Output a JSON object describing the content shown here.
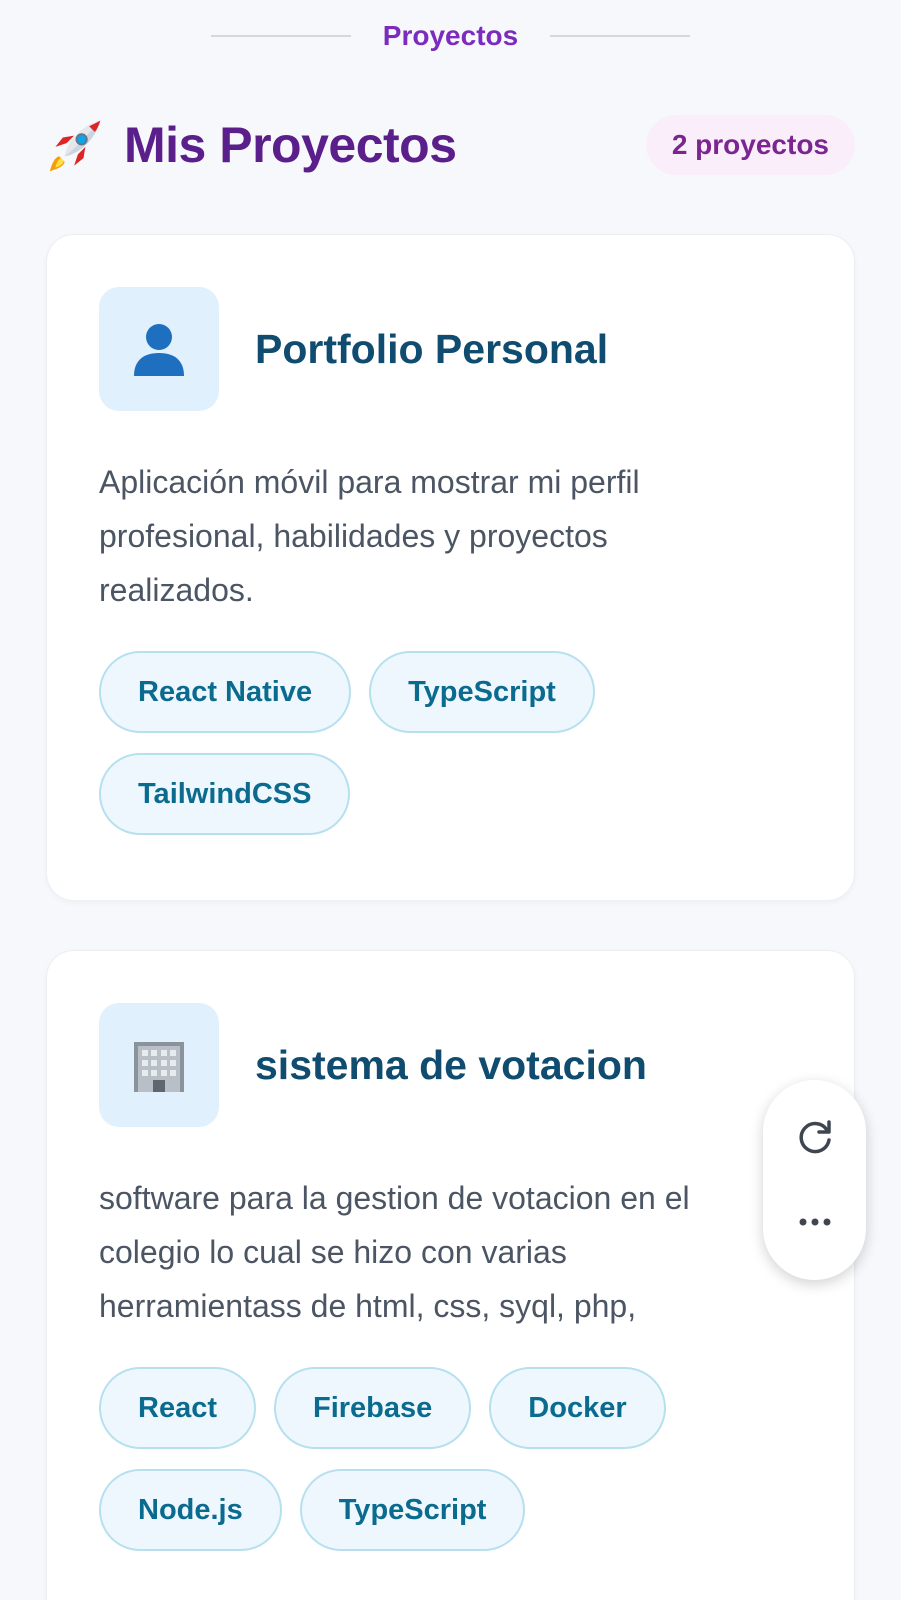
{
  "section": {
    "title": "Proyectos"
  },
  "heading": {
    "icon": "rocket-icon",
    "title": "Mis Proyectos",
    "count_label": "2 proyectos"
  },
  "projects": [
    {
      "icon": "person-icon",
      "title": "Portfolio Personal",
      "description": "Aplicación móvil para mostrar mi perfil profesional, habilidades y proyectos realizados.",
      "tags": [
        "React Native",
        "TypeScript",
        "TailwindCSS"
      ]
    },
    {
      "icon": "office-building-icon",
      "title": "sistema de votacion",
      "description": "software para la gestion de votacion en el colegio lo cual se hizo con varias herramientass de html, css, syql, php,",
      "tags": [
        "React",
        "Firebase",
        "Docker",
        "Node.js",
        "TypeScript"
      ]
    }
  ],
  "floating_actions": [
    "refresh-icon",
    "more-options-icon"
  ],
  "colors": {
    "accent_purple": "#7b2cbf",
    "heading_purple": "#5a1f8a",
    "card_title": "#0f4c6f",
    "tag_text": "#0b6b8f",
    "tag_border": "#b7e0ef",
    "background": "#f6f8fb"
  }
}
